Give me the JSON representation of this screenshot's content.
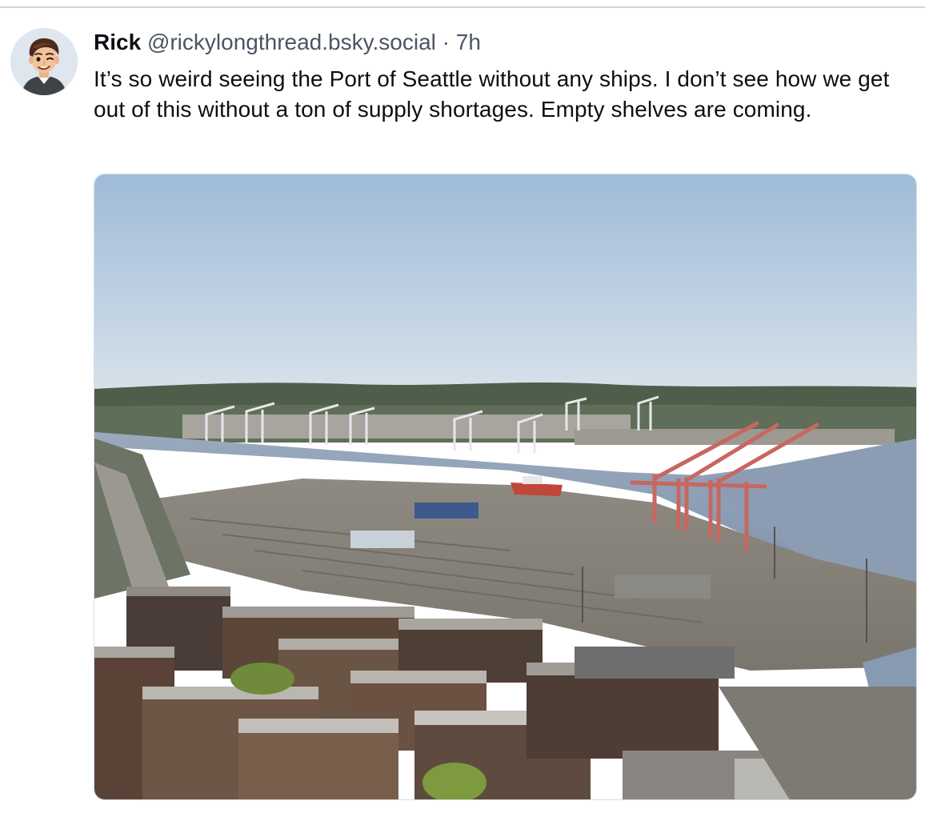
{
  "post": {
    "author_name": "Rick",
    "author_handle": "@rickylongthread.bsky.social",
    "separator": "·",
    "time": "7h",
    "text": "It’s so weird seeing the Port of Seattle without any ships. I don’t see how we get out of this without a ton of supply shortages. Empty shelves are coming.",
    "avatar_icon": "cartoon-man-avatar",
    "image_subject": "aerial-photo"
  },
  "colors": {
    "text_primary": "#0b0f14",
    "text_secondary": "#4b5563",
    "divider": "#c9d3df",
    "crane_red": "#c8675f",
    "water": "#8fa3bd",
    "sky": "#b7cde4"
  }
}
